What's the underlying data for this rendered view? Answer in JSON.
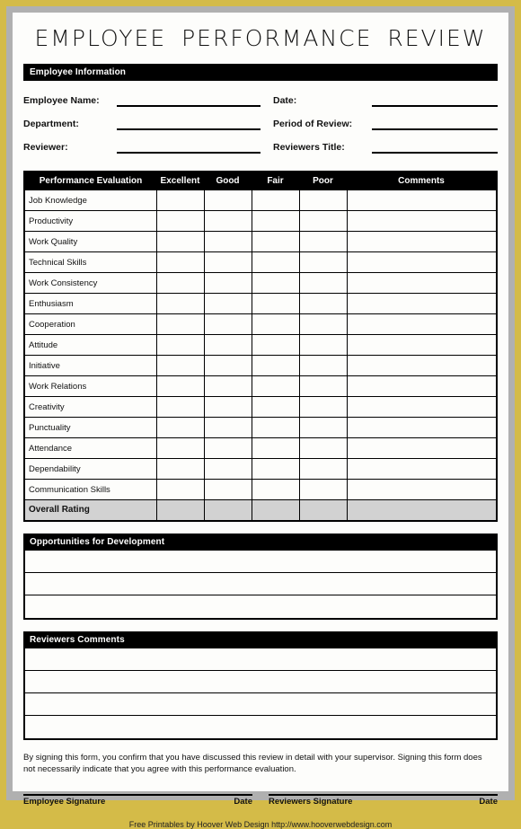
{
  "document": {
    "title": "EMPLOYEE  PERFORMANCE  REVIEW"
  },
  "employee_information": {
    "banner": "Employee Information",
    "left_fields": [
      {
        "label": "Employee Name:",
        "value": ""
      },
      {
        "label": "Department:",
        "value": ""
      },
      {
        "label": "Reviewer:",
        "value": ""
      }
    ],
    "right_fields": [
      {
        "label": "Date:",
        "value": ""
      },
      {
        "label": "Period of Review:",
        "value": ""
      },
      {
        "label": "Reviewers Title:",
        "value": ""
      }
    ]
  },
  "evaluation_table": {
    "columns": [
      "Performance Evaluation",
      "Excellent",
      "Good",
      "Fair",
      "Poor",
      "Comments"
    ],
    "criteria": [
      "Job Knowledge",
      "Productivity",
      "Work Quality",
      "Technical Skills",
      "Work Consistency",
      "Enthusiasm",
      "Cooperation",
      "Attitude",
      "Initiative",
      "Work Relations",
      "Creativity",
      "Punctuality",
      "Attendance",
      "Dependability",
      "Communication Skills"
    ],
    "overall_row_label": "Overall Rating",
    "overall_row_fill": "#d2d2d2"
  },
  "opportunities": {
    "banner": "Opportunities for Development",
    "line_count": 3
  },
  "reviewers_comments": {
    "banner": "Reviewers Comments",
    "line_count": 4
  },
  "disclaimer": {
    "text": "By signing this form, you confirm that you have discussed this review in detail with your supervisor. Signing this form does not necessarily indicate that you agree with this performance evaluation."
  },
  "signatures": {
    "employee_label": "Employee Signature",
    "employee_date_label": "Date",
    "reviewer_label": "Reviewers Signature",
    "reviewer_date_label": "Date"
  },
  "footer": {
    "credit": "Free Printables by Hoover Web Design http://www.hooverwebdesign.com"
  },
  "theme": {
    "frame_color": "#d4bb48",
    "mat_color": "#b0b0b0",
    "page_color": "#fdfdfb",
    "banner_color": "#000000",
    "shade_color": "#d2d2d2"
  }
}
